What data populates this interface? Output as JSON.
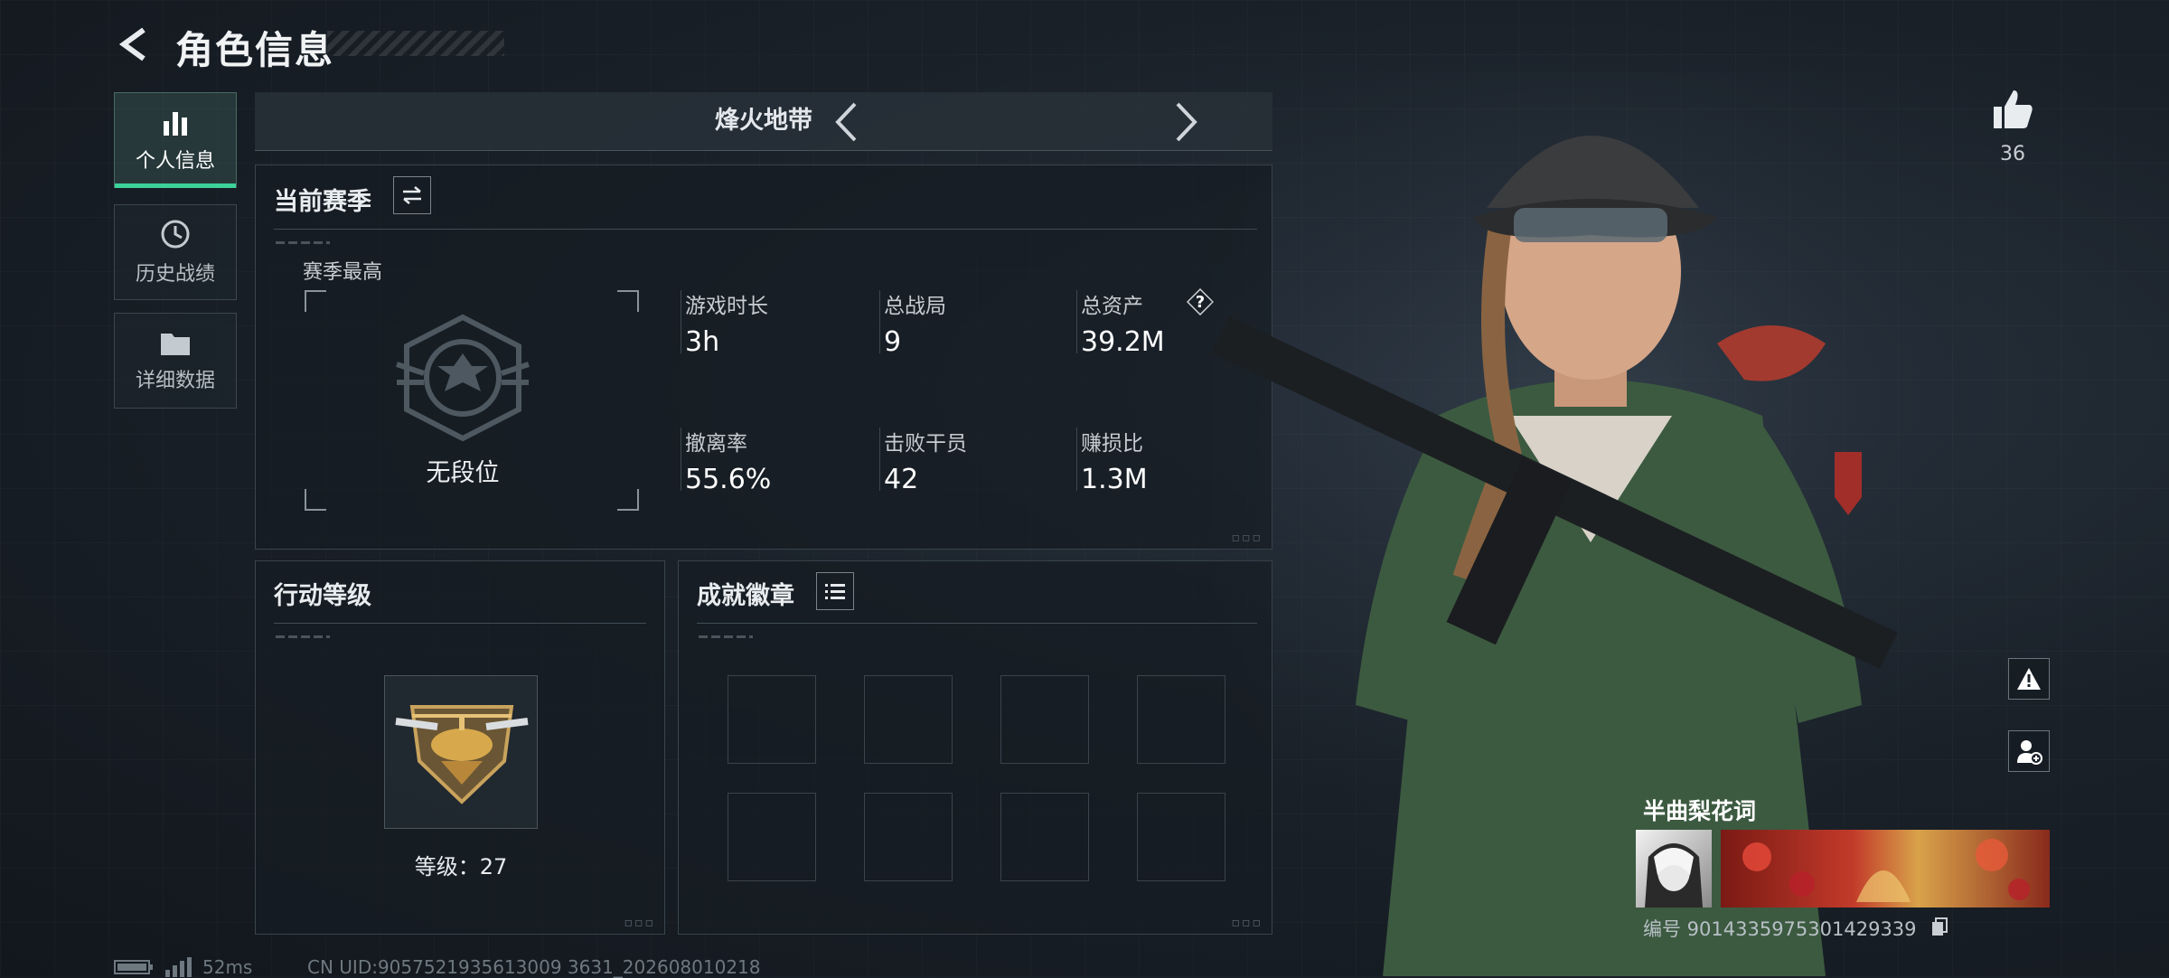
{
  "header": {
    "title": "角色信息"
  },
  "nav": [
    {
      "label": "个人信息",
      "icon": "bar-chart-icon",
      "active": true
    },
    {
      "label": "历史战绩",
      "icon": "history-icon",
      "active": false
    },
    {
      "label": "详细数据",
      "icon": "folder-icon",
      "active": false
    }
  ],
  "mode": {
    "name": "烽火地带"
  },
  "season": {
    "title": "当前赛季",
    "best_label": "赛季最高",
    "rank": "无段位",
    "stats": [
      {
        "label": "游戏时长",
        "value": "3h"
      },
      {
        "label": "总战局",
        "value": "9"
      },
      {
        "label": "总资产",
        "value": "39.2M",
        "help": "?"
      },
      {
        "label": "撤离率",
        "value": "55.6%"
      },
      {
        "label": "击败干员",
        "value": "42"
      },
      {
        "label": "赚损比",
        "value": "1.3M"
      }
    ]
  },
  "level": {
    "title": "行动等级",
    "text": "等级：27"
  },
  "achievements": {
    "title": "成就徽章"
  },
  "likes": {
    "count": "36"
  },
  "player": {
    "name": "半曲梨花词",
    "id": "编号 9014335975301429339"
  },
  "footer": {
    "ping": "52ms",
    "uid": "CN UID:9057521935613009 3631_202608010218"
  },
  "colors": {
    "accent": "#3bd39a",
    "panel_border": "#3a444d",
    "background": "#1a2129"
  }
}
